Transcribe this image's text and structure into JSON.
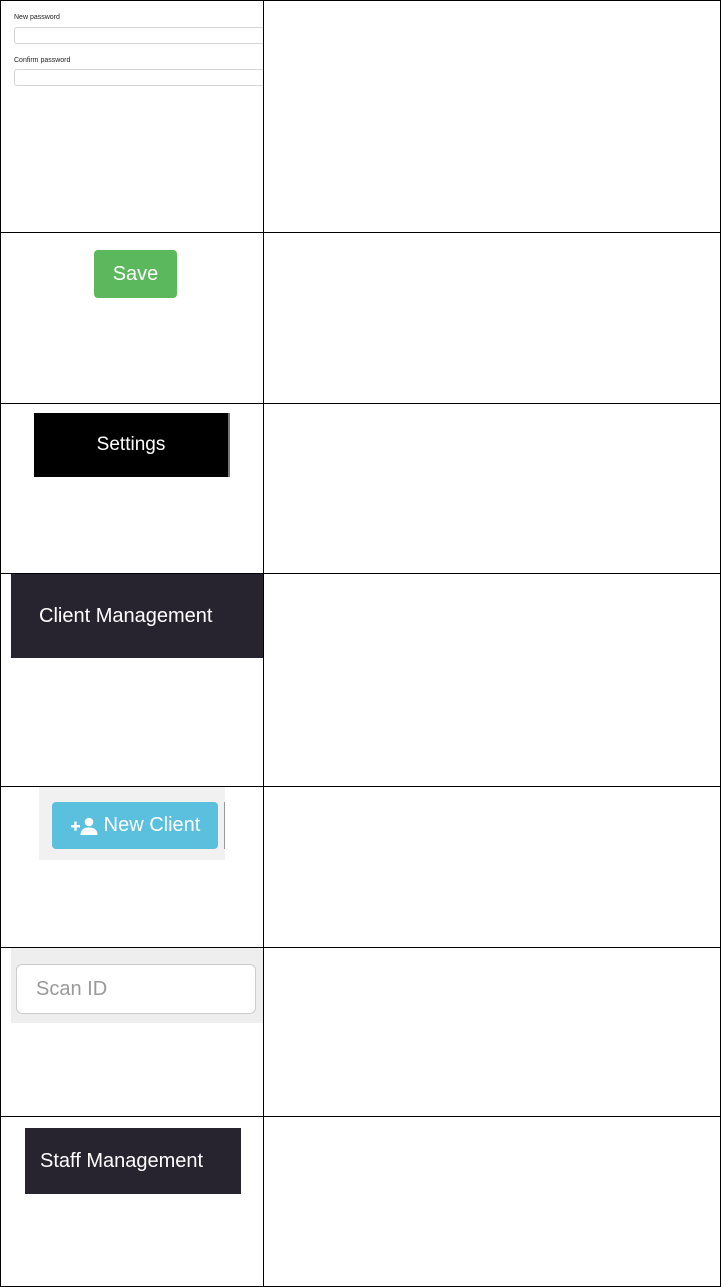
{
  "rows": [
    {
      "left": {
        "type": "password-form",
        "new_password_label": "New password",
        "confirm_password_label": "Confirm password"
      },
      "right": ""
    },
    {
      "left": {
        "type": "button",
        "label": "Save",
        "color": "#5cb85c"
      },
      "right": ""
    },
    {
      "left": {
        "type": "nav",
        "label": "Settings",
        "color": "#000000"
      },
      "right": ""
    },
    {
      "left": {
        "type": "nav",
        "label": "Client Management",
        "color": "#272430"
      },
      "right": ""
    },
    {
      "left": {
        "type": "button",
        "label": "New Client",
        "icon": "add-person-icon",
        "color": "#5bc0de"
      },
      "right": ""
    },
    {
      "left": {
        "type": "input",
        "placeholder": "Scan ID"
      },
      "right": ""
    },
    {
      "left": {
        "type": "nav",
        "label": "Staff Management",
        "color": "#272430"
      },
      "right": ""
    }
  ]
}
